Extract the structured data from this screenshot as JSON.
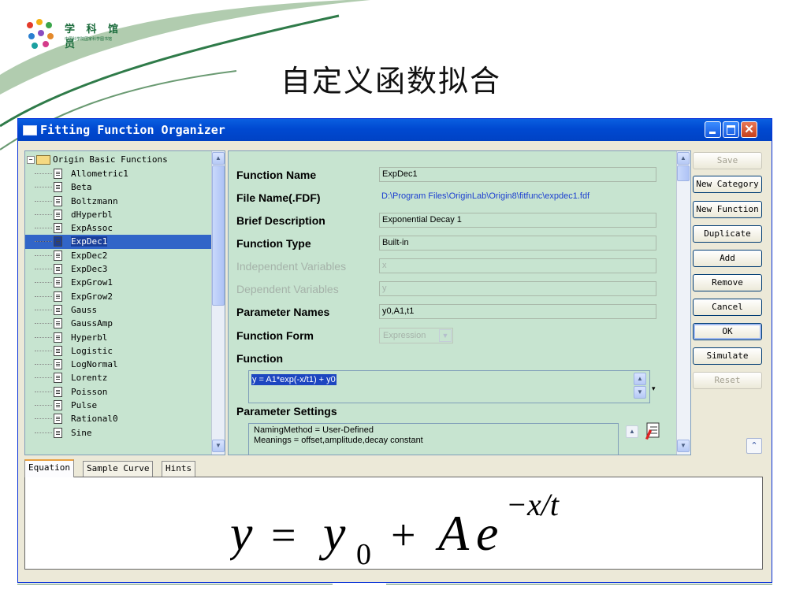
{
  "slide": {
    "logo_text": "学 科 馆 员",
    "logo_subtext": "中国科学院国家科学图书馆",
    "title": "自定义函数拟合"
  },
  "window": {
    "title": "Fitting Function Organizer",
    "title_bar_color": "#0049d1"
  },
  "tree": {
    "root_label": "Origin Basic Functions",
    "items": [
      {
        "label": "Allometric1",
        "selected": false
      },
      {
        "label": "Beta",
        "selected": false
      },
      {
        "label": "Boltzmann",
        "selected": false
      },
      {
        "label": "dHyperbl",
        "selected": false
      },
      {
        "label": "ExpAssoc",
        "selected": false
      },
      {
        "label": "ExpDec1",
        "selected": true
      },
      {
        "label": "ExpDec2",
        "selected": false
      },
      {
        "label": "ExpDec3",
        "selected": false
      },
      {
        "label": "ExpGrow1",
        "selected": false
      },
      {
        "label": "ExpGrow2",
        "selected": false
      },
      {
        "label": "Gauss",
        "selected": false
      },
      {
        "label": "GaussAmp",
        "selected": false
      },
      {
        "label": "Hyperbl",
        "selected": false
      },
      {
        "label": "Logistic",
        "selected": false
      },
      {
        "label": "LogNormal",
        "selected": false
      },
      {
        "label": "Lorentz",
        "selected": false
      },
      {
        "label": "Poisson",
        "selected": false
      },
      {
        "label": "Pulse",
        "selected": false
      },
      {
        "label": "Rational0",
        "selected": false
      },
      {
        "label": "Sine",
        "selected": false
      }
    ]
  },
  "form": {
    "function_name": {
      "label": "Function Name",
      "value": "ExpDec1"
    },
    "file_name": {
      "label": "File Name(.FDF)",
      "value": "D:\\Program Files\\OriginLab\\Origin8\\fitfunc\\expdec1.fdf"
    },
    "brief_description": {
      "label": "Brief Description",
      "value": "Exponential Decay 1"
    },
    "function_type": {
      "label": "Function Type",
      "value": "Built-in"
    },
    "independent_variables": {
      "label": "Independent Variables",
      "value": "x"
    },
    "dependent_variables": {
      "label": "Dependent Variables",
      "value": "y"
    },
    "parameter_names": {
      "label": "Parameter Names",
      "value": "y0,A1,t1"
    },
    "function_form": {
      "label": "Function Form",
      "value": "Expression"
    },
    "function": {
      "label": "Function",
      "value": "y = A1*exp(-x/t1) + y0"
    },
    "parameter_settings": {
      "label": "Parameter Settings",
      "lines": [
        "NamingMethod = User-Defined",
        "Meanings = offset,amplitude,decay constant"
      ]
    }
  },
  "buttons": {
    "save": "Save",
    "new_category": "New Category",
    "new_function": "New Function",
    "duplicate": "Duplicate",
    "add": "Add",
    "remove": "Remove",
    "cancel": "Cancel",
    "ok": "OK",
    "simulate": "Simulate",
    "reset": "Reset"
  },
  "tabs": [
    {
      "label": "Equation",
      "active": true
    },
    {
      "label": "Sample Curve",
      "active": false
    },
    {
      "label": "Hints",
      "active": false
    }
  ],
  "equation": {
    "lhs": "y",
    "equals": "=",
    "base": "y",
    "sub": "0",
    "plus": "+",
    "coef": "A",
    "exp_base": "e",
    "exponent": "−x/t"
  }
}
